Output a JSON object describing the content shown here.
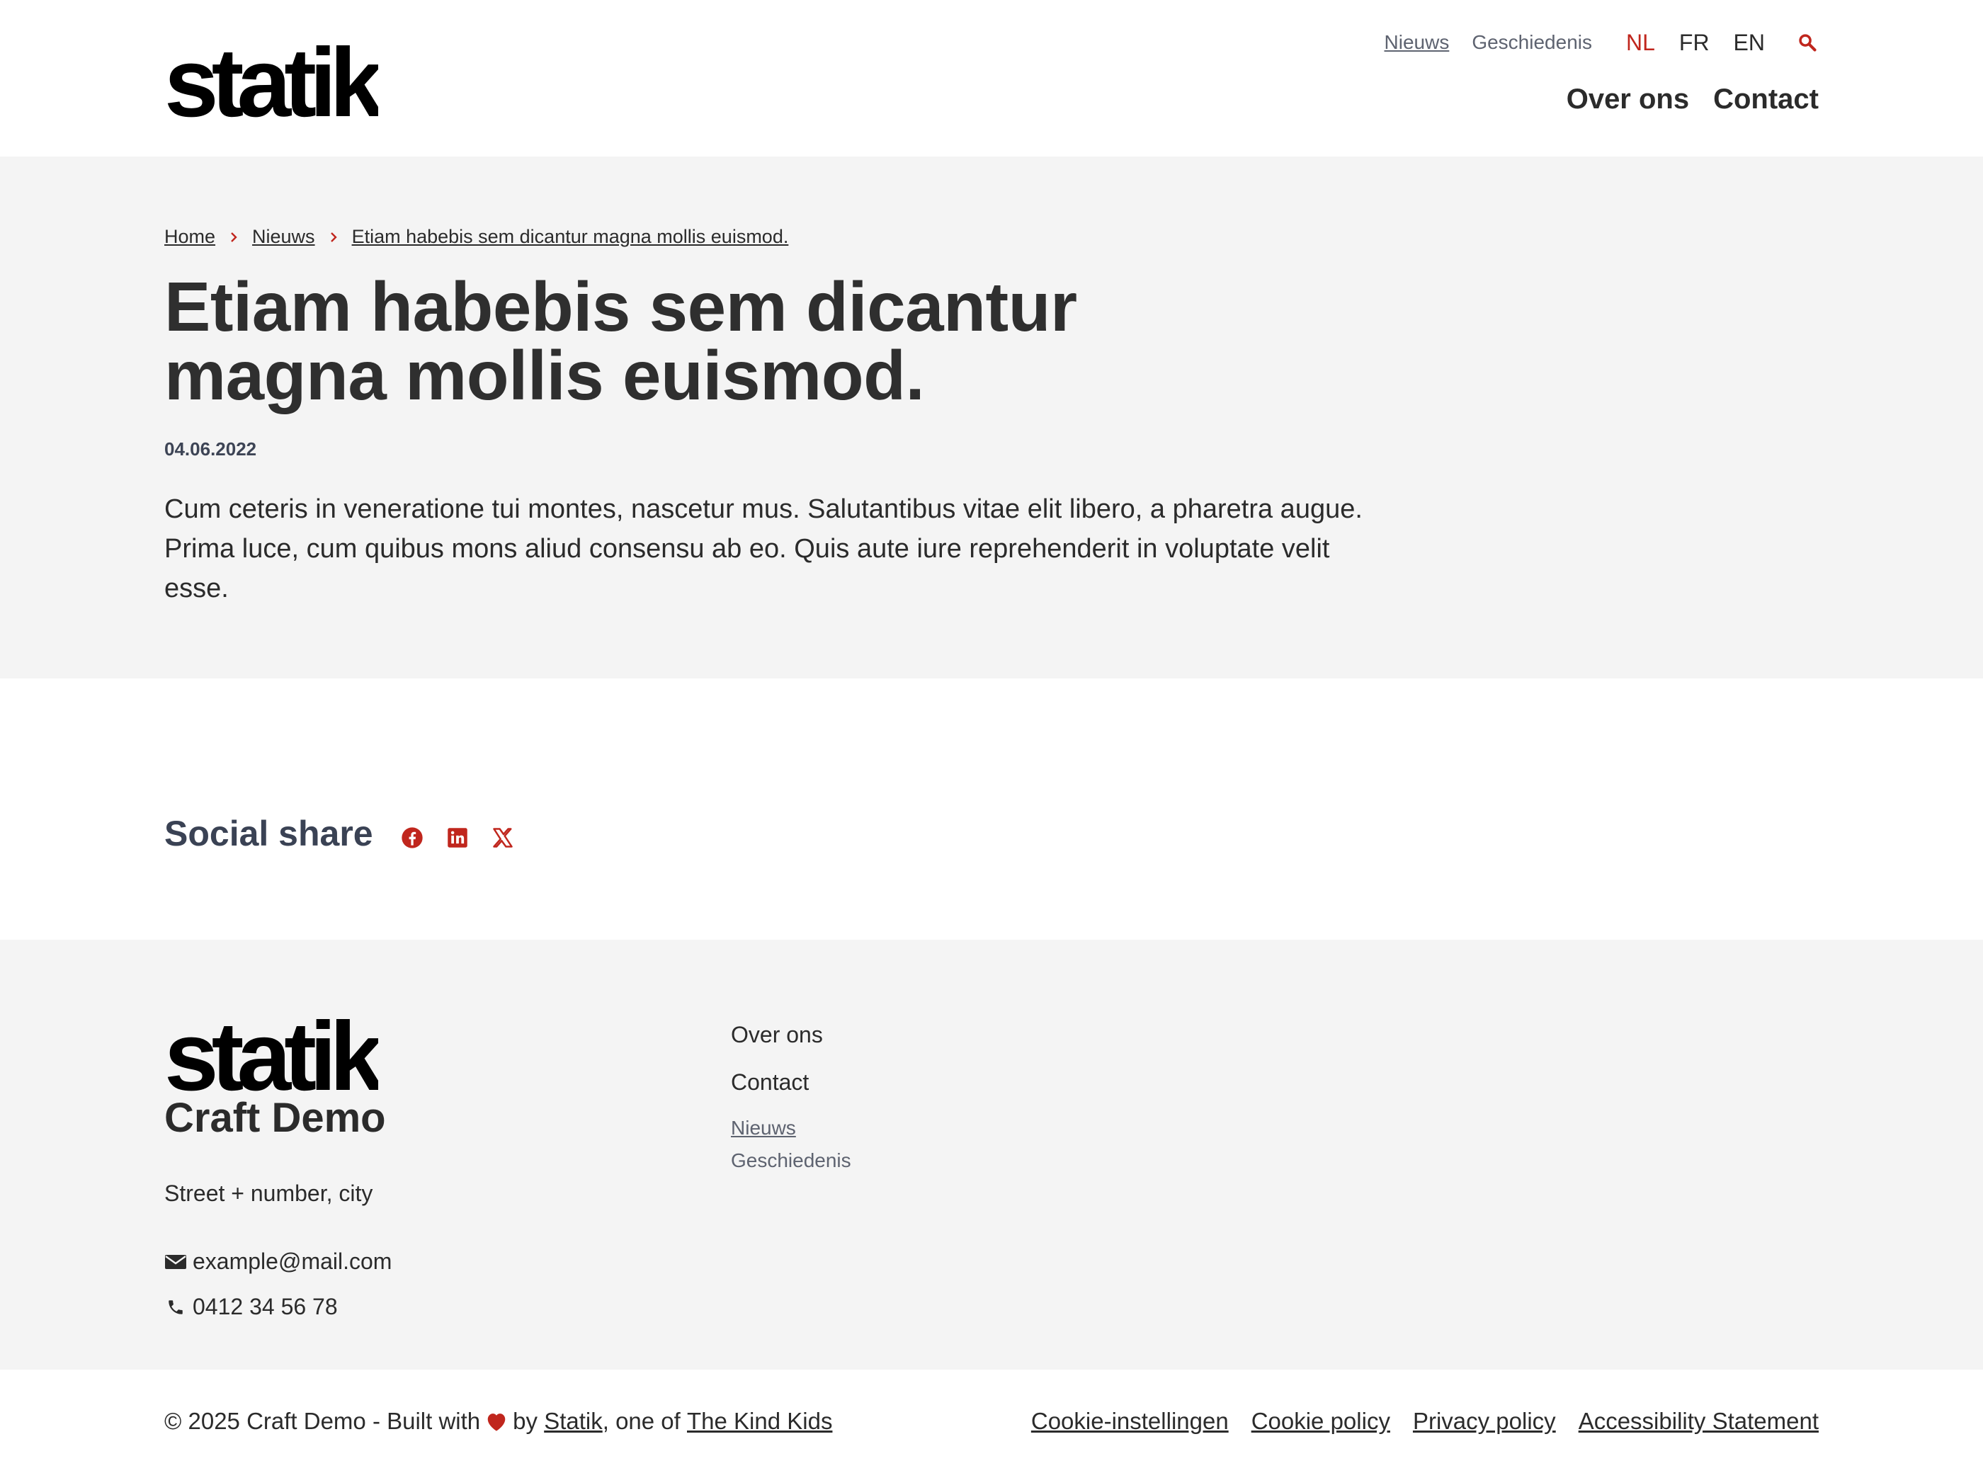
{
  "header": {
    "logo_text": "statik",
    "secondary_nav": [
      {
        "label": "Nieuws"
      },
      {
        "label": "Geschiedenis"
      }
    ],
    "languages": [
      {
        "label": "NL"
      },
      {
        "label": "FR"
      },
      {
        "label": "EN"
      }
    ],
    "main_nav": [
      {
        "label": "Over ons"
      },
      {
        "label": "Contact"
      }
    ]
  },
  "breadcrumb": [
    {
      "label": "Home"
    },
    {
      "label": "Nieuws"
    },
    {
      "label": "Etiam habebis sem dicantur magna mollis euismod."
    }
  ],
  "article": {
    "title_line1": "Etiam habebis sem dicantur",
    "title_line2": "magna mollis euismod.",
    "date": "04.06.2022",
    "intro": "Cum ceteris in veneratione tui montes, nascetur mus. Salutantibus vitae elit libero, a pharetra augue. Prima luce, cum quibus mons aliud consensu ab eo. Quis aute iure reprehenderit in voluptate velit esse."
  },
  "social_share": {
    "title": "Social share",
    "icons": [
      "facebook-icon",
      "linkedin-icon",
      "x-icon"
    ]
  },
  "footer": {
    "logo_text": "statik",
    "site_name": "Craft Demo",
    "address": "Street + number, city",
    "email": "example@mail.com",
    "phone": "0412 34 56 78",
    "main_nav": [
      {
        "label": "Over ons"
      },
      {
        "label": "Contact"
      }
    ],
    "secondary_nav": [
      {
        "label": "Nieuws"
      },
      {
        "label": "Geschiedenis"
      }
    ]
  },
  "bottom": {
    "copyright_prefix": "© 2025 Craft Demo - Built with",
    "by": "by",
    "statik_link": "Statik",
    "one_of": ", one of",
    "kind_kids_link": "The Kind Kids",
    "legal_links": [
      {
        "label": "Cookie-instellingen"
      },
      {
        "label": "Cookie policy"
      },
      {
        "label": "Privacy policy"
      },
      {
        "label": "Accessibility Statement"
      }
    ]
  },
  "colors": {
    "accent": "#c0261d",
    "text": "#2b2b2b",
    "muted": "#5e6370",
    "band": "#f4f4f4"
  }
}
